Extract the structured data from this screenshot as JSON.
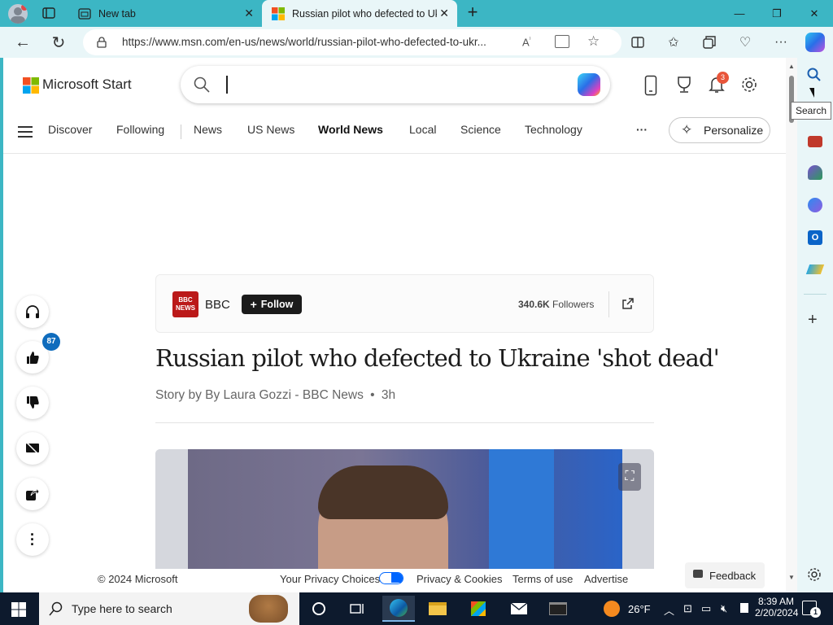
{
  "browser": {
    "tabs": [
      {
        "title": "New tab"
      },
      {
        "title": "Russian pilot who defected to Uk"
      }
    ],
    "url": "https://www.msn.com/en-us/news/world/russian-pilot-who-defected-to-ukr...",
    "tooltip": "Search"
  },
  "header": {
    "logo_text": "Microsoft Start",
    "notif_count": "3"
  },
  "nav": {
    "items": [
      "Discover",
      "Following",
      "News",
      "US News",
      "World News",
      "Local",
      "Science",
      "Technology"
    ],
    "more": "···",
    "personalize": "Personalize"
  },
  "article": {
    "source": "BBC",
    "source_logo_lines": [
      "BBC",
      "NEWS"
    ],
    "follow": "Follow",
    "followers_count": "340.6K",
    "followers_label": "Followers",
    "title": "Russian pilot who defected to Ukraine 'shot dead'",
    "byline": "Story by By Laura Gozzi - BBC News",
    "dot": "•",
    "age": "3h",
    "likes": "87"
  },
  "footer": {
    "copyright": "© 2024 Microsoft",
    "privacy_choices": "Your Privacy Choices",
    "privacy_cookies": "Privacy & Cookies",
    "terms": "Terms of use",
    "advertise": "Advertise",
    "feedback": "Feedback"
  },
  "taskbar": {
    "search_placeholder": "Type here to search",
    "temperature": "26°F",
    "time": "8:39 AM",
    "date": "2/20/2024",
    "notif_count": "1"
  },
  "colors": {
    "browser_frame": "#3cb6c4",
    "toolbar": "#e9f6f8",
    "accent_blue": "#0078d4",
    "bbc_red": "#bb1919"
  }
}
